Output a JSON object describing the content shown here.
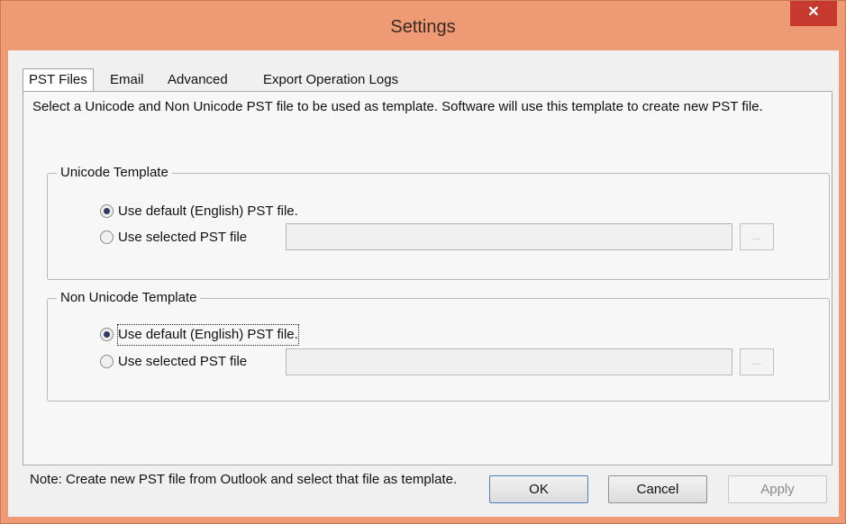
{
  "window": {
    "title": "Settings"
  },
  "tabs": [
    {
      "label": "PST Files"
    },
    {
      "label": "Email"
    },
    {
      "label": "Advanced"
    },
    {
      "label": "Export Operation Logs"
    }
  ],
  "description": "Select a Unicode and Non Unicode PST file to be used as template. Software will use this template to create new PST file.",
  "unicode": {
    "legend": "Unicode Template",
    "default_label": "Use default (English) PST file.",
    "selected_label": "Use selected PST file",
    "path_value": "",
    "browse_label": "..."
  },
  "non_unicode": {
    "legend": "Non Unicode Template",
    "default_label": "Use default (English) PST file.",
    "selected_label": "Use selected PST file",
    "path_value": "",
    "browse_label": "..."
  },
  "note": "Note: Create new PST file from Outlook and select that file as template.",
  "buttons": {
    "ok": "OK",
    "cancel": "Cancel",
    "apply": "Apply"
  },
  "close_glyph": "✕"
}
